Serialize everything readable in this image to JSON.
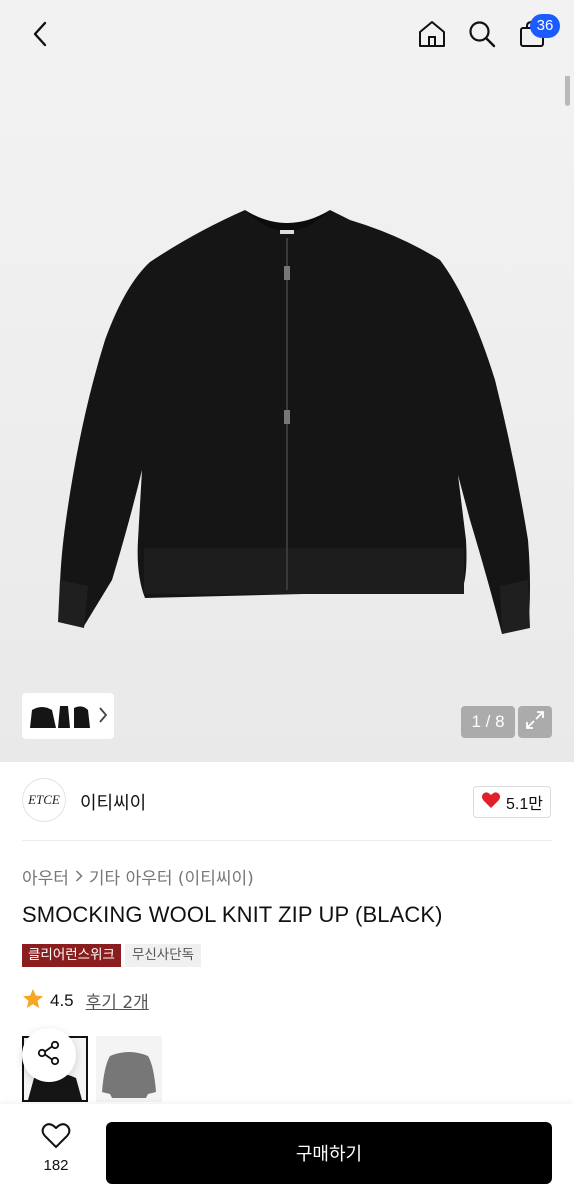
{
  "header": {
    "back_icon": "chevron-left-icon",
    "home_icon": "home-icon",
    "search_icon": "search-icon",
    "cart_icon": "shopping-bag-icon",
    "cart_badge": "36"
  },
  "gallery": {
    "counter": "1 / 8",
    "expand_icon": "expand-icon",
    "thumbnail_arrow_icon": "chevron-right-icon"
  },
  "brand": {
    "logo_text": "ETCE",
    "name": "이티씨이",
    "like_count": "5.1만"
  },
  "breadcrumb": {
    "items": [
      "아우터",
      "기타 아우터 (이티씨이)"
    ],
    "separator_icon": "chevron-right-icon"
  },
  "product": {
    "title": "SMOCKING WOOL KNIT ZIP UP (BLACK)",
    "badges": [
      "클리어런스위크",
      "무신사단독"
    ],
    "rating": "4.5",
    "review_link": "후기 2개"
  },
  "bottom_bar": {
    "wish_count": "182",
    "buy_label": "구매하기"
  },
  "colors": {
    "badge_blue": "#1a5cff",
    "badge_red": "#8a1e1e",
    "heart_red": "#e0202a",
    "star": "#f5a623",
    "buy_button": "#000000"
  }
}
